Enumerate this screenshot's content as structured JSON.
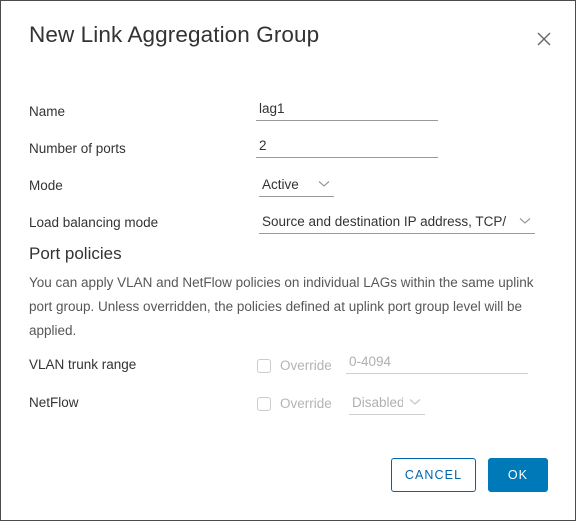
{
  "dialog": {
    "title": "New Link Aggregation Group",
    "close_icon": "close-icon"
  },
  "form": {
    "name": {
      "label": "Name",
      "value": "lag1",
      "placeholder": ""
    },
    "number_of_ports": {
      "label": "Number of ports",
      "value": "2",
      "placeholder": ""
    },
    "mode": {
      "label": "Mode",
      "value": "Active"
    },
    "load_balancing_mode": {
      "label": "Load balancing mode",
      "value": "Source and destination IP address, TCP/"
    }
  },
  "port_policies": {
    "title": "Port policies",
    "description": "You can apply VLAN and NetFlow policies on individual LAGs within the same uplink port group. Unless overridden, the policies defined at uplink port group level will be applied.",
    "vlan_trunk_range": {
      "label": "VLAN trunk range",
      "override_label": "Override",
      "override_checked": false,
      "value": "0-4094"
    },
    "netflow": {
      "label": "NetFlow",
      "override_label": "Override",
      "override_checked": false,
      "value": "Disabled"
    }
  },
  "footer": {
    "cancel_label": "CANCEL",
    "ok_label": "OK"
  },
  "colors": {
    "primary": "#0079b8",
    "link": "#0065ab",
    "text": "#333333",
    "muted": "#b4b4b4",
    "border": "#9a9a9a"
  }
}
